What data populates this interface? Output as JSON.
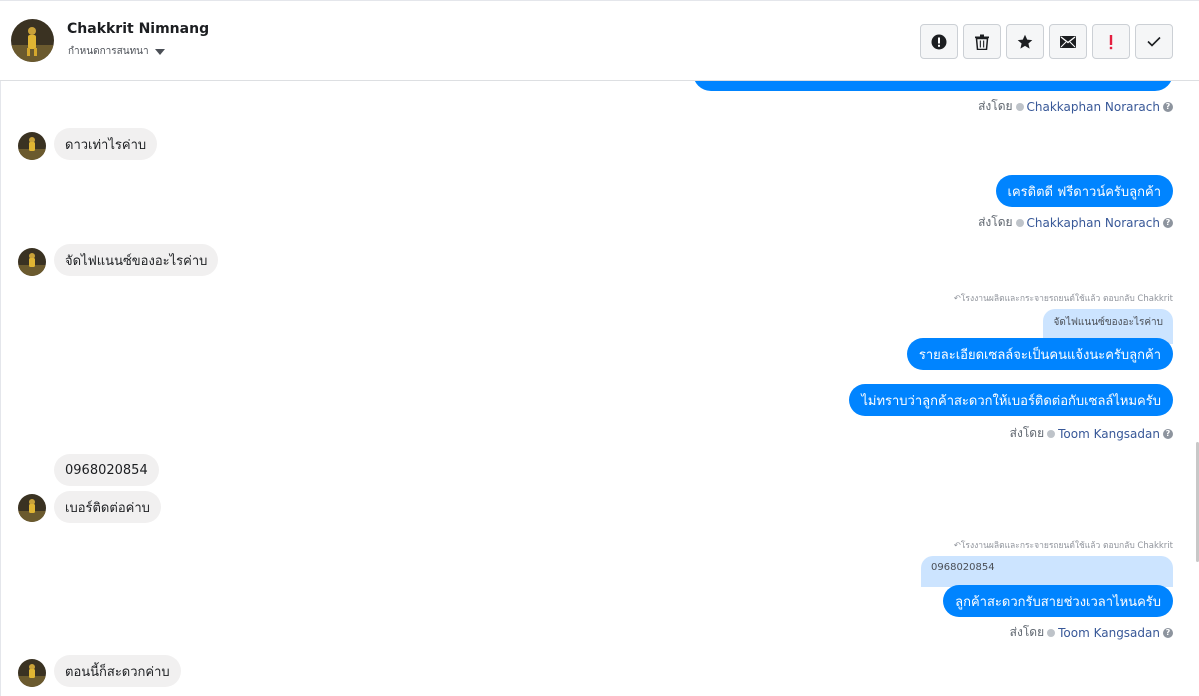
{
  "header": {
    "contact_name": "Chakkrit Nimnang",
    "label_select": "กำหนดการสนทนา",
    "toolbar": [
      {
        "name": "report-icon"
      },
      {
        "name": "trash-icon"
      },
      {
        "name": "star-icon"
      },
      {
        "name": "mail-icon"
      },
      {
        "name": "important-icon"
      },
      {
        "name": "done-check-icon"
      }
    ],
    "toolbar_important_color": "#e41e3f"
  },
  "messages": {
    "sent_by_label": "ส่งโดย",
    "first_sentby_sender": "Chakkaphan Norarach",
    "in1": "ดาวเท่าไรค่าบ",
    "out1": "เครดิตดี ฟรีดาวน์ครับลูกค้า",
    "out1_sender": "Chakkaphan Norarach",
    "in2": "จัดไฟแนนซ์ของอะไรค่าบ",
    "reply1_head": "โรงงานผลิตและกระจายรถยนต์ใช้แล้ว ตอบกลับ Chakkrit",
    "reply1_quote": "จัดไฟแนนซ์ของอะไรค่าบ",
    "out2": "รายละเอียดเซลล์จะเป็นคนแจ้งนะครับลูกค้า",
    "out3": "ไม่ทราบว่าลูกค้าสะดวกให้เบอร์ติดต่อกับเซลล์ไหมครับ",
    "out3_sender": "Toom Kangsadan",
    "in3": "0968020854",
    "in4": "เบอร์ติดต่อค่าบ",
    "reply2_head": "โรงงานผลิตและกระจายรถยนต์ใช้แล้ว ตอบกลับ Chakkrit",
    "reply2_quote": "0968020854",
    "out4": "ลูกค้าสะดวกรับสายช่วงเวลาไหนครับ",
    "out4_sender": "Toom Kangsadan",
    "in5": "ตอนนี้ก็สะดวกค่าบ"
  },
  "colors": {
    "accent": "#0084ff",
    "bubble_in": "#f1f0f0",
    "quote_bg": "#cce4ff",
    "sender_link": "#385898"
  }
}
